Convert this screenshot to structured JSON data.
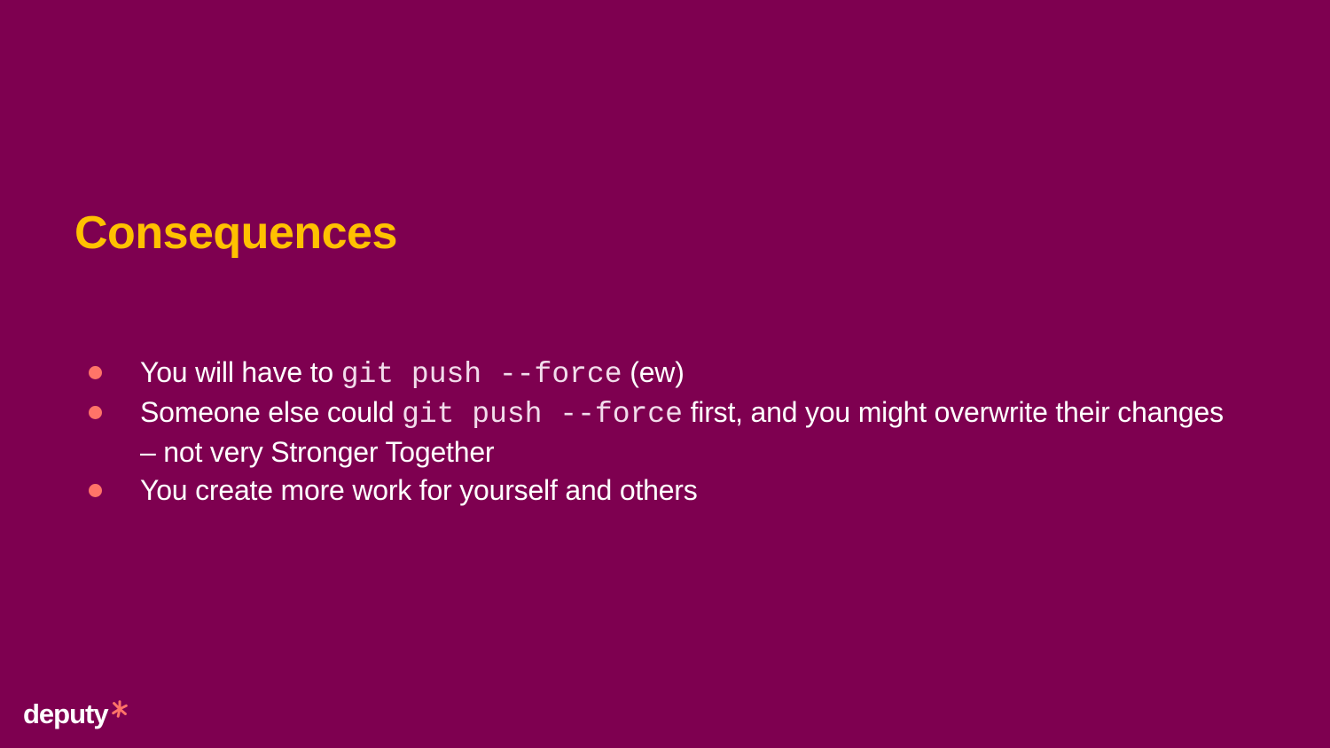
{
  "slide": {
    "title": "Consequences",
    "bullets": [
      {
        "parts": [
          {
            "text": "You will have to ",
            "code": false
          },
          {
            "text": "git push --force",
            "code": true
          },
          {
            "text": " (ew)",
            "code": false
          }
        ]
      },
      {
        "parts": [
          {
            "text": "Someone else could ",
            "code": false
          },
          {
            "text": "git push --force",
            "code": true
          },
          {
            "text": " first, and you might overwrite their changes – not very Stronger Together",
            "code": false
          }
        ]
      },
      {
        "parts": [
          {
            "text": "You create more work for yourself and others",
            "code": false
          }
        ]
      }
    ]
  },
  "footer": {
    "logo_text": "deputy",
    "logo_icon": "deputy-asterisk-icon"
  },
  "colors": {
    "background": "#7e0050",
    "title": "#ffc100",
    "bullet_dot": "#ff7468",
    "text": "#ffffff",
    "logo_accent": "#ff7468"
  }
}
